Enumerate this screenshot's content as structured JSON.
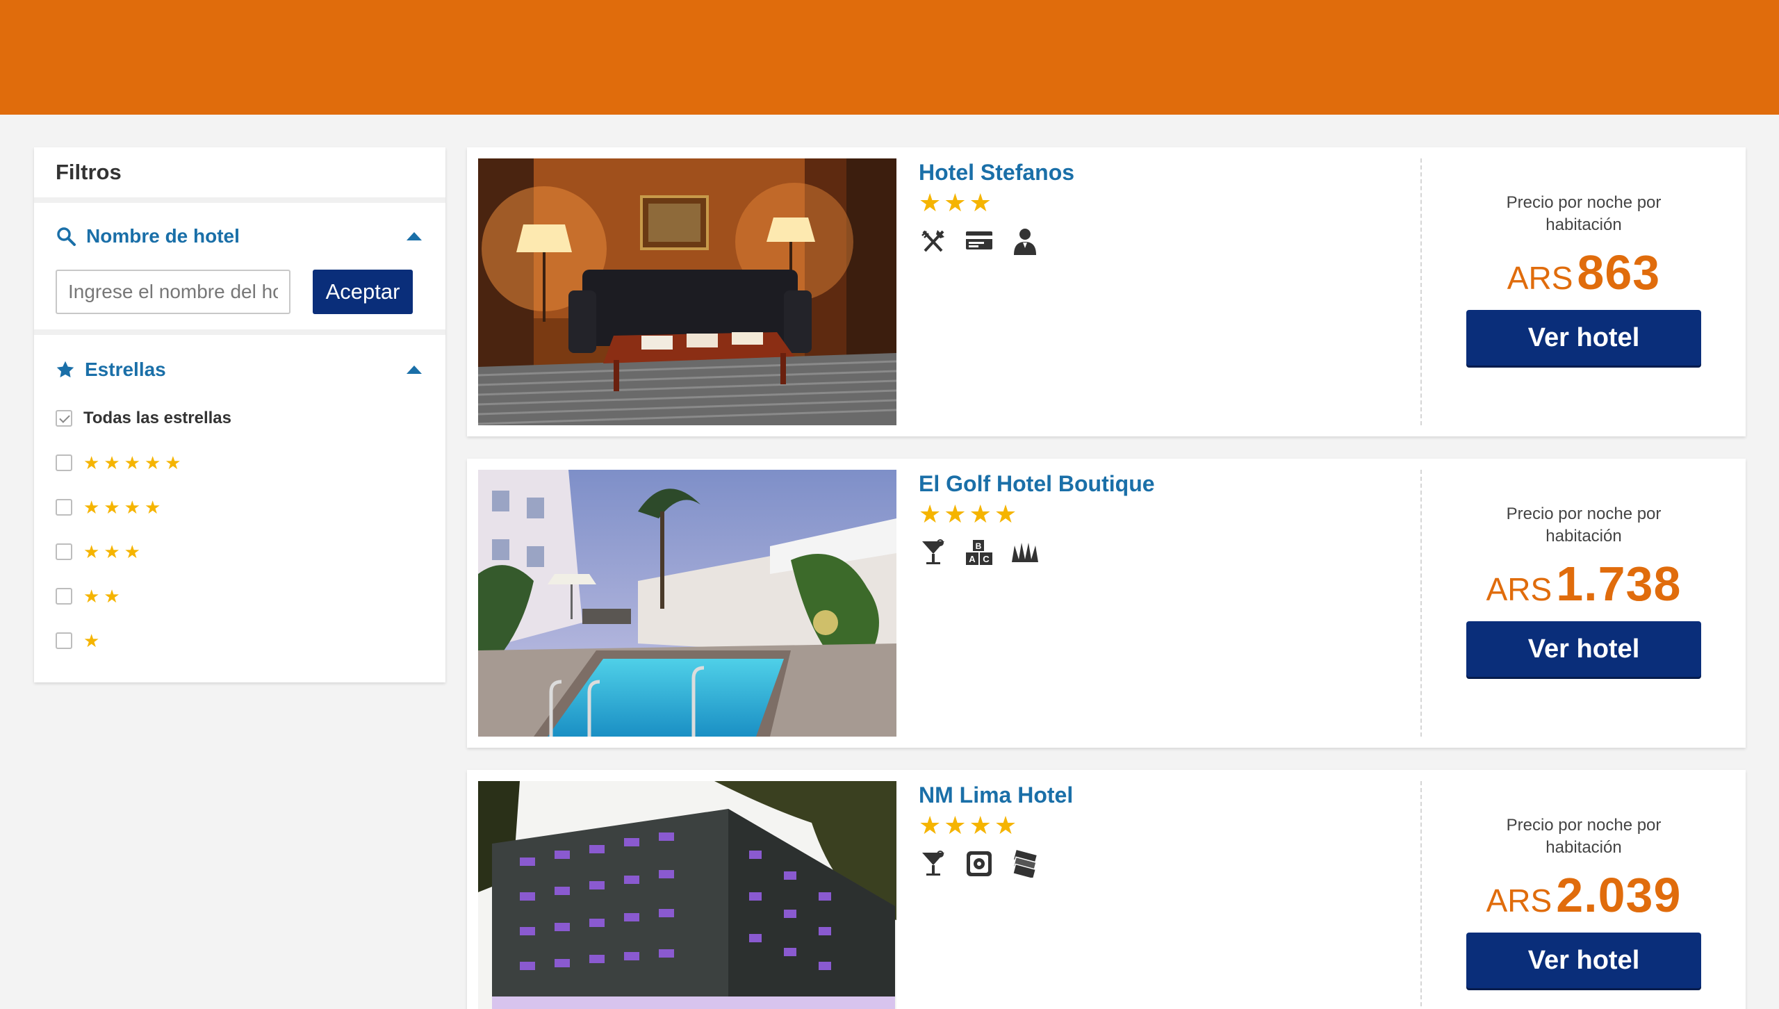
{
  "colors": {
    "brand_orange": "#e06c0c",
    "navy_button": "#0a2e7a",
    "link_blue": "#1a6fa8",
    "star_gold": "#f5b400"
  },
  "filters": {
    "title": "Filtros",
    "name_section": {
      "title": "Nombre de hotel",
      "icon": "search-icon",
      "placeholder": "Ingrese el nombre del hotel",
      "value": "",
      "button": "Aceptar"
    },
    "stars_section": {
      "title": "Estrellas",
      "icon": "star-icon",
      "all_label": "Todas las estrellas",
      "all_checked": true,
      "options": [
        {
          "stars": 5,
          "checked": false
        },
        {
          "stars": 4,
          "checked": false
        },
        {
          "stars": 3,
          "checked": false
        },
        {
          "stars": 2,
          "checked": false
        },
        {
          "stars": 1,
          "checked": false
        }
      ]
    }
  },
  "hotels": [
    {
      "name": "Hotel Stefanos",
      "stars": 3,
      "amenities": [
        "restaurant-icon",
        "credit-card-icon",
        "concierge-icon"
      ],
      "price_label": "Precio por noche por habitación",
      "currency": "ARS",
      "price": "863",
      "button": "Ver hotel",
      "image": "hotel-room-photo"
    },
    {
      "name": "El Golf Hotel Boutique",
      "stars": 4,
      "amenities": [
        "bar-icon",
        "kids-club-icon",
        "garden-icon"
      ],
      "price_label": "Precio por noche por habitación",
      "currency": "ARS",
      "price": "1.738",
      "button": "Ver hotel",
      "image": "hotel-pool-photo"
    },
    {
      "name": "NM Lima Hotel",
      "stars": 4,
      "amenities": [
        "bar-icon",
        "safe-box-icon",
        "currency-exchange-icon"
      ],
      "price_label": "Precio por noche por habitación",
      "currency": "ARS",
      "price": "2.039",
      "button": "Ver hotel",
      "image": "hotel-facade-photo"
    }
  ]
}
